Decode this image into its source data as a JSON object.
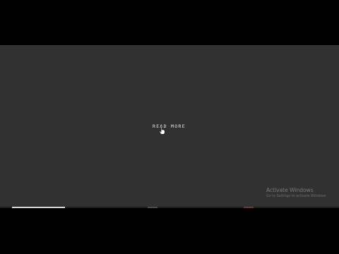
{
  "content": {
    "read_more_label": "READ MORE"
  },
  "watermark": {
    "title": "Activate Windows",
    "subtitle": "Go to Settings to activate Windows."
  },
  "player": {
    "progress_fraction": 0.25
  },
  "colors": {
    "screen_background": "#313131",
    "letterbox": "#000000",
    "progress_fill": "#d8d8d8"
  },
  "icons": {
    "cursor": "hand-pointer-icon"
  }
}
